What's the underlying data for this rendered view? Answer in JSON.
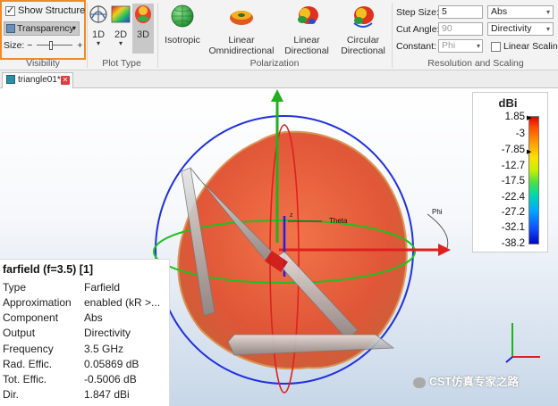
{
  "ribbon": {
    "visibility": {
      "show_structure_label": "Show Structure",
      "show_structure_checked": true,
      "transparency_label": "Transparency",
      "size_label": "Size:",
      "size_minus": "−",
      "size_plus": "+",
      "size_value": 0.35,
      "group_label": "Visibility"
    },
    "plot_type": {
      "buttons": [
        {
          "label": "1D",
          "has_dropdown": true
        },
        {
          "label": "2D",
          "has_dropdown": true
        },
        {
          "label": "3D",
          "active": true
        }
      ],
      "group_label": "Plot Type"
    },
    "polarization": {
      "buttons": [
        {
          "label_line1": "Isotropic",
          "label_line2": ""
        },
        {
          "label_line1": "Linear",
          "label_line2": "Omnidirectional"
        },
        {
          "label_line1": "Linear",
          "label_line2": "Directional"
        },
        {
          "label_line1": "Circular",
          "label_line2": "Directional"
        }
      ],
      "group_label": "Polarization"
    },
    "resolution": {
      "step_size_label": "Step Size:",
      "step_size_value": "5",
      "cut_angle_label": "Cut Angle:",
      "cut_angle_value": "90",
      "constant_label": "Constant:",
      "constant_value": "Phi",
      "abs_value": "Abs",
      "directivity_value": "Directivity",
      "linear_scaling_label": "Linear Scaling",
      "linear_scaling_checked": false,
      "group_label": "Resolution and Scaling"
    }
  },
  "tab": {
    "label": "triangle01*",
    "close_symbol": "✕"
  },
  "viewport": {
    "axis_labels": {
      "theta": "Theta",
      "phi": "Phi",
      "z": "z"
    },
    "colorbar": {
      "unit": "dBi",
      "ticks": [
        "1.85",
        "-3",
        "-7.85",
        "-12.7",
        "-17.5",
        "-22.4",
        "-27.2",
        "-32.1",
        "-38.2"
      ]
    },
    "colors": {
      "pattern": "#e8402a",
      "ring": "#2030e0",
      "equator": "#20c020",
      "x_axis": "#e02020",
      "y_axis": "#20b020",
      "z_axis": "#2020e0"
    }
  },
  "info_panel": {
    "title": "farfield (f=3.5) [1]",
    "rows": [
      {
        "key": "Type",
        "value": "Farfield"
      },
      {
        "key": "Approximation",
        "value": "enabled (kR >..."
      },
      {
        "key": "Component",
        "value": "Abs"
      },
      {
        "key": "Output",
        "value": "Directivity"
      },
      {
        "key": "Frequency",
        "value": "3.5 GHz"
      },
      {
        "key": "Rad. Effic.",
        "value": "0.05869 dB"
      },
      {
        "key": "Tot. Effic.",
        "value": "-0.5006 dB"
      },
      {
        "key": "Dir.",
        "value": "1.847 dBi"
      }
    ]
  },
  "watermark": "CST仿真专家之路"
}
